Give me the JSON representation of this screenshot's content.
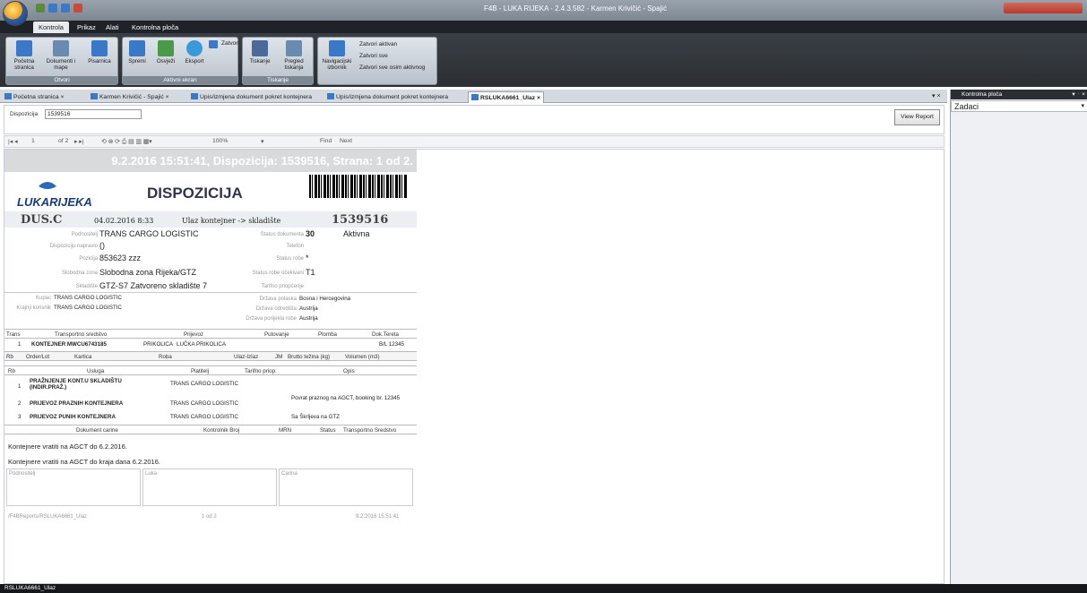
{
  "window": {
    "title": "F4B - LUKA RIJEKA - 2.4.3.582 - Karmen  Krivičić - Spajić"
  },
  "ribbon_tabs": [
    "Kontrola",
    "Prikaz",
    "Alati",
    "Kontrolna ploča"
  ],
  "ribbon": {
    "groups": {
      "otvori": {
        "label": "Otvori",
        "buttons": [
          "Početna stranica",
          "Dokumenti i mape",
          "Pisarnica"
        ]
      },
      "aktivni": {
        "label": "Aktivni ekran",
        "buttons": [
          "Spremi",
          "Osvježi",
          "Eksport"
        ],
        "zatvori": "Zatvori"
      },
      "tiskanje": {
        "label": "Tiskanje",
        "buttons": [
          "Tiskanje",
          "Pregled tiskanja"
        ]
      },
      "nav": {
        "button": "Navigacijski izbornik",
        "items": [
          "Zatvori aktivan",
          "Zatvori sve",
          "Zatvori sve osim aktivnog"
        ]
      }
    }
  },
  "doc_tabs": [
    "Početna stranica",
    "Karmen Krivičić - Spajić",
    "Upis/izmjena dokument pokret kontejnera",
    "Upis/izmjena dokument pokret kontejnera",
    "RSLUKA6661_Ulaz"
  ],
  "right_panel": {
    "title": "Kontrolna ploča",
    "selected": "Zadaci"
  },
  "params": {
    "disp_label": "Dispozicija",
    "disp_value": "1539516",
    "view_report": "View Report"
  },
  "report_toolbar": {
    "page": "1",
    "of": "of 2",
    "zoom": "100%",
    "find": "Find",
    "next": "Next"
  },
  "report": {
    "header": "9.2.2016 15:51:41, Dispozicija: 1539516, Strana:  1 od 2.",
    "logo": "LUKARIJEKA",
    "title": "DISPOZICIJA",
    "code": "DUS.C",
    "date": "04.02.2016 8:33",
    "direction": "Ulaz kontejner -> skladište",
    "number": "1539516",
    "fields": {
      "podnositelj_l": "Podnositelj",
      "podnositelj": "TRANS CARGO LOGISTIC",
      "napravio_l": "Dispoziciju napravio",
      "napravio": "()",
      "pozicija_l": "Pozicija",
      "pozicija": "853623 zzz",
      "zona_l": "Slobodna zona",
      "zona": "Slobodna zona Rijeka/GTZ",
      "skladiste_l": "Skladište",
      "skladiste": "GTZ-S7 Zatvoreno skladište 7",
      "status_dok_l": "Status dokumenta",
      "status_dok_code": "30",
      "status_dok": "Aktivna",
      "telefon_l": "Telefon",
      "status_robe_l": "Status robe",
      "status_robe": "*",
      "status_ocek_l": "Status robe očekivani",
      "status_ocek": "T1",
      "tarifno_l": "Tarifno priopćenje",
      "kupac_l": "Kupac",
      "kupac": "TRANS CARGO LOGISTIC",
      "krajnji_l": "Krajnji korisnik",
      "krajnji": "TRANS CARGO LOGISTIC",
      "drz_pol_l": "Država polaska",
      "drz_pol": "Bosna i Hercegovina",
      "drz_odr_l": "Država odredišta",
      "drz_odr": "Austrija",
      "drz_por_l": "Država porijekla robe",
      "drz_por": "Austrija"
    },
    "trans_headers": [
      "Trans",
      "Transportno sredstvo",
      "Prijevoz",
      "Putovanje",
      "Plomba",
      "Dok.Tereta"
    ],
    "trans_row": [
      "1",
      "KONTEJNER  MWCU6743185",
      "PRIKOLICA",
      "LUČKA PRIKOLICA",
      "B/L 12345"
    ],
    "order_headers": [
      "Rb",
      "Order/Lot",
      "Kartica",
      "Roba",
      "Ulaz-Izlaz",
      "JM",
      "Brutto težina (kg)",
      "Volumen (m3)"
    ],
    "usluga_headers": [
      "Rb",
      "Usluga",
      "Platitelj",
      "Tarifno priop.",
      "Opis"
    ],
    "usluge": [
      {
        "rb": "1",
        "usluga": "PRAŽNJENJE KONT.U SKLADIŠTU (INDIR.PRAŽ.)",
        "platitelj": "TRANS CARGO LOGISTIC",
        "opis": ""
      },
      {
        "rb": "2",
        "usluga": "PRIJEVOZ PRAZNIH KONTEJNERA",
        "platitelj": "TRANS CARGO LOGISTIC",
        "opis": "Povrat praznog na AGCT, booking br. 12345"
      },
      {
        "rb": "3",
        "usluga": "PRIJEVOZ PUNIH KONTEJNERA",
        "platitelj": "TRANS CARGO LOGISTIC",
        "opis": "Sa Škrljeva na GTZ"
      }
    ],
    "carine_headers": [
      "Dokument carine",
      "Kontrolnik Broj",
      "MRN",
      "Status",
      "Transportno Sredstvo"
    ],
    "notes": [
      "Kontejnere vratiti na AGCT do 6.2.2016.",
      "Kontejnere vratiti na AGCT do kraja dana 6.2.2016."
    ],
    "sign": [
      "Podnositelj",
      "Luka",
      "Carina"
    ],
    "footer": {
      "path": "/F4BReports/RSLUKA6661_Ulaz",
      "page": "1 od 2",
      "time": "9.2.2016 15:51:41"
    }
  },
  "statusbar": "RSLUKA6661_Ulaz"
}
